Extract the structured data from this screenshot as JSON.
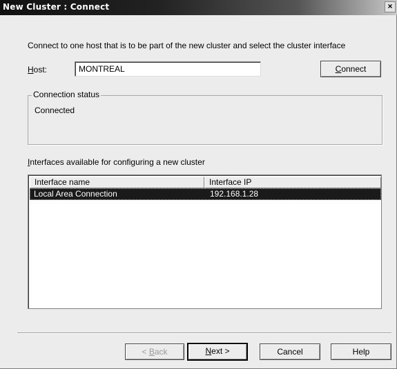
{
  "window": {
    "title": "New Cluster : Connect",
    "close_glyph": "×"
  },
  "instruction": "Connect to one host that is to be part of the new cluster and select the cluster interface",
  "host": {
    "label_accel": "H",
    "label_rest": "ost:",
    "value": "MONTREAL"
  },
  "connect_button": {
    "accel": "C",
    "rest": "onnect"
  },
  "connection_status": {
    "legend": "Connection status",
    "text": "Connected"
  },
  "interfaces": {
    "label_accel": "I",
    "label_rest": "nterfaces available for configuring a new cluster",
    "columns": [
      "Interface name",
      "Interface IP"
    ],
    "rows": [
      {
        "name": "Local Area Connection",
        "ip": "192.168.1.28",
        "selected": true
      }
    ]
  },
  "buttons": {
    "back_prefix": "< ",
    "back_accel": "B",
    "back_rest": "ack",
    "next_accel": "N",
    "next_rest": "ext >",
    "cancel": "Cancel",
    "help": "Help"
  }
}
